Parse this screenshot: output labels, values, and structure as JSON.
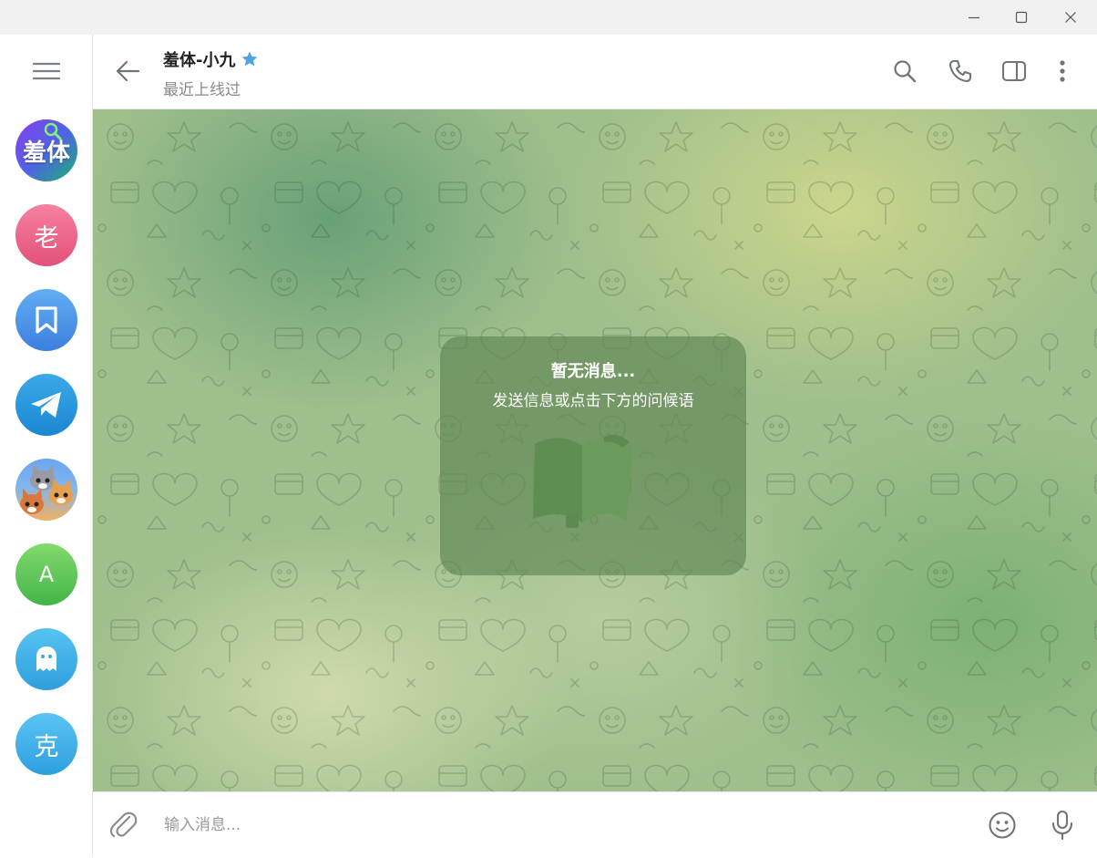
{
  "window": {
    "controls": [
      "minimize",
      "maximize",
      "close"
    ]
  },
  "sidebar": {
    "menu_icon": "hamburger-menu-icon",
    "chats": [
      {
        "id": "xiuti",
        "label": "羞体",
        "colors": [
          "#7b3fe4",
          "#1fae6a"
        ]
      },
      {
        "id": "lao",
        "label": "老",
        "colors": [
          "#f47aa0",
          "#e04f7a"
        ]
      },
      {
        "id": "saved",
        "label": "",
        "icon": "bookmark-icon",
        "colors": [
          "#5aa8f0",
          "#3b7fe0"
        ]
      },
      {
        "id": "telegram",
        "label": "",
        "icon": "telegram-plane-icon",
        "colors": [
          "#38a7e6",
          "#1c8ad6"
        ]
      },
      {
        "id": "cats",
        "label": "",
        "icon": "cats-cartoon-avatar",
        "colors": [
          "#5b9be8",
          "#e7a45a"
        ]
      },
      {
        "id": "a",
        "label": "A",
        "colors": [
          "#7ed86a",
          "#45b84a"
        ]
      },
      {
        "id": "ghost",
        "label": "",
        "icon": "ghost-icon",
        "colors": [
          "#52c0f0",
          "#2fa0de"
        ]
      },
      {
        "id": "ke",
        "label": "克",
        "colors": [
          "#55c2f2",
          "#2e9fdf"
        ]
      }
    ]
  },
  "header": {
    "title": "羞体-小九",
    "verified_icon": "star-badge-icon",
    "verified_color": "#4fa3e0",
    "status": "最近上线过",
    "actions": [
      "search-icon",
      "phone-icon",
      "sidebar-panel-icon",
      "more-vertical-icon"
    ]
  },
  "chat": {
    "empty_title": "暂无消息...",
    "empty_subtitle": "发送信息或点击下方的问候语",
    "sticker_icon": "book-sticker-icon"
  },
  "composer": {
    "placeholder": "输入消息...",
    "attach_icon": "paperclip-icon",
    "emoji_icon": "emoji-icon",
    "mic_icon": "microphone-icon"
  },
  "colors": {
    "icon_gray": "#707579",
    "accent": "#3390ec"
  }
}
